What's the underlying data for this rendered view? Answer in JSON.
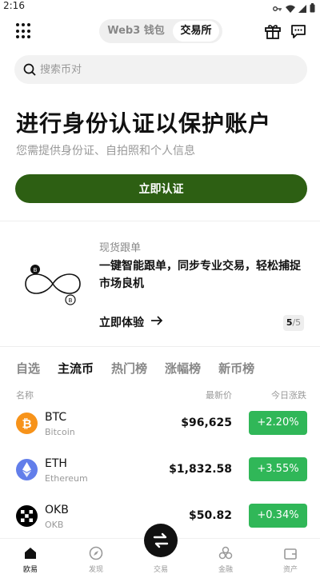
{
  "status": {
    "time": "2:16"
  },
  "header": {
    "segments": [
      "Web3 钱包",
      "交易所"
    ],
    "active_segment": "交易所"
  },
  "search": {
    "placeholder": "搜索币对"
  },
  "kyc": {
    "title": "进行身份认证以保护账户",
    "subtitle": "您需提供身份证、自拍照和个人信息",
    "button": "立即认证",
    "button_color": "#2d5f13"
  },
  "promo": {
    "tag": "现货跟单",
    "text": "一键智能跟单，同步专业交易，轻松捕捉市场良机",
    "cta": "立即体验",
    "page_current": "5",
    "page_total": "/5"
  },
  "market": {
    "tabs": [
      "自选",
      "主流币",
      "热门榜",
      "涨幅榜",
      "新币榜"
    ],
    "active_tab": "主流币",
    "columns": {
      "name": "名称",
      "price": "最新价",
      "change": "今日涨跌"
    },
    "rows": [
      {
        "symbol": "BTC",
        "name": "Bitcoin",
        "price": "$96,625",
        "change": "+2.20%",
        "icon": "btc-icon",
        "color": "#f7931a"
      },
      {
        "symbol": "ETH",
        "name": "Ethereum",
        "price": "$1,832.58",
        "change": "+3.55%",
        "icon": "eth-icon",
        "color": "#627eea"
      },
      {
        "symbol": "OKB",
        "name": "OKB",
        "price": "$50.82",
        "change": "+0.34%",
        "icon": "okb-icon",
        "color": "#000000"
      }
    ],
    "positive_color": "#30b758"
  },
  "nav": {
    "items": [
      "欧易",
      "发现",
      "交易",
      "金融",
      "资产"
    ],
    "active": "欧易"
  }
}
